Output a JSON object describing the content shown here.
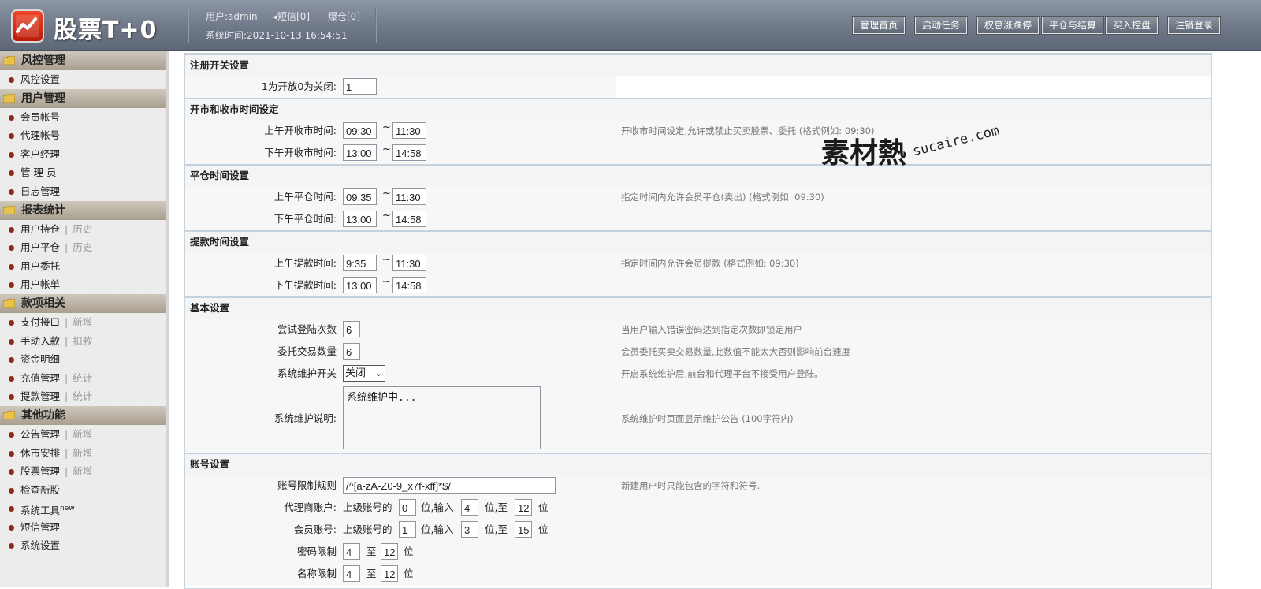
{
  "header": {
    "logo_text": "股票T+0",
    "user_line": "用户:admin",
    "sms": "短信[0]",
    "liquidation": "爆仓[0]",
    "time_line": "系统时间:2021-10-13 16:54:51",
    "buttons": [
      "管理首页",
      "启动任务",
      "权息涨跌停",
      "平仓与结算",
      "买入控盘",
      "注销登录"
    ]
  },
  "sidebar": {
    "sections": [
      {
        "title": "风控管理",
        "items": [
          {
            "label": "风控设置"
          }
        ]
      },
      {
        "title": "用户管理",
        "items": [
          {
            "label": "会员帐号"
          },
          {
            "label": "代理帐号"
          },
          {
            "label": "客户经理"
          },
          {
            "label": "管 理 员"
          },
          {
            "label": "日志管理"
          }
        ]
      },
      {
        "title": "报表统计",
        "items": [
          {
            "label": "用户持仓",
            "sub": "历史"
          },
          {
            "label": "用户平仓",
            "sub": "历史"
          },
          {
            "label": "用户委托"
          },
          {
            "label": "用户帐单"
          }
        ]
      },
      {
        "title": "款项相关",
        "items": [
          {
            "label": "支付接口",
            "sub": "新增"
          },
          {
            "label": "手动入款",
            "sub": "扣款"
          },
          {
            "label": "资金明细"
          },
          {
            "label": "充值管理",
            "sub": "统计"
          },
          {
            "label": "提款管理",
            "sub": "统计"
          }
        ]
      },
      {
        "title": "其他功能",
        "items": [
          {
            "label": "公告管理",
            "sub": "新增"
          },
          {
            "label": "休市安排",
            "sub": "新增"
          },
          {
            "label": "股票管理",
            "sub": "新增"
          },
          {
            "label": "检查新股"
          },
          {
            "label": "系统工具",
            "badge": "new"
          },
          {
            "label": "短信管理"
          },
          {
            "label": "系统设置"
          }
        ]
      }
    ]
  },
  "main": {
    "reg": {
      "title": "注册开关设置",
      "label": "1为开放0为关闭:",
      "value": "1"
    },
    "market": {
      "title": "开市和收市时间设定",
      "am_label": "上午开收市时间:",
      "am_from": "09:30",
      "am_to": "11:30",
      "pm_label": "下午开收市时间:",
      "pm_from": "13:00",
      "pm_to": "14:58",
      "hint": "开收市时间设定,允许或禁止买卖股票、委托 (格式例如: 09:30)"
    },
    "close": {
      "title": "平仓时间设置",
      "am_label": "上午平仓时间:",
      "am_from": "09:35",
      "am_to": "11:30",
      "pm_label": "下午平仓时间:",
      "pm_from": "13:00",
      "pm_to": "14:58",
      "hint": "指定时间内允许会员平仓(卖出) (格式例如: 09:30)"
    },
    "withdraw": {
      "title": "提款时间设置",
      "am_label": "上午提款时间:",
      "am_from": "9:35",
      "am_to": "11:30",
      "pm_label": "下午提款时间:",
      "pm_from": "13:00",
      "pm_to": "14:58",
      "hint": "指定时间内允许会员提款 (格式例如: 09:30)"
    },
    "basic": {
      "title": "基本设置",
      "login_label": "尝试登陆次数",
      "login_value": "6",
      "login_hint": "当用户输入错误密码达到指定次数即锁定用户",
      "order_label": "委托交易数量",
      "order_value": "6",
      "order_hint": "会员委托买卖交易数量,此数值不能太大否则影响前台速度",
      "maint_label": "系统维护开关",
      "maint_value": "关闭",
      "maint_hint": "开启系统维护后,前台和代理平台不接受用户登陆。",
      "desc_label": "系统维护说明:",
      "desc_value": "系统维护中...",
      "desc_hint": "系统维护时页面显示维护公告 (100字符内)"
    },
    "account": {
      "title": "账号设置",
      "rule_label": "账号限制规则",
      "rule_value": "/^[a-zA-Z0-9_x7f-xff]*$/",
      "rule_hint": "新建用户时只能包含的字符和符号.",
      "agent_label": "代理商账户:",
      "agent_prefix": "上级账号的",
      "agent_a": "0",
      "agent_mid": "位,输入",
      "agent_b": "4",
      "agent_to": "位,至",
      "agent_c": "12",
      "agent_unit": "位",
      "member_label": "会员账号:",
      "member_prefix": "上级账号的",
      "member_a": "1",
      "member_mid": "位,输入",
      "member_b": "3",
      "member_to": "位,至",
      "member_c": "15",
      "member_unit": "位",
      "pwd_label": "密码限制",
      "pwd_a": "4",
      "pwd_to": "至",
      "pwd_b": "12",
      "pwd_unit": "位",
      "name_label": "名称限制",
      "name_a": "4",
      "name_to": "至",
      "name_b": "12",
      "name_unit": "位"
    }
  },
  "watermark": {
    "cn": "素材熱",
    "en": "sucaire.com"
  },
  "colors": {
    "header": "#6f7888",
    "section_bar": "#b8ae9f",
    "bullet": "#8a2b1e",
    "logo": "#d82a14"
  }
}
